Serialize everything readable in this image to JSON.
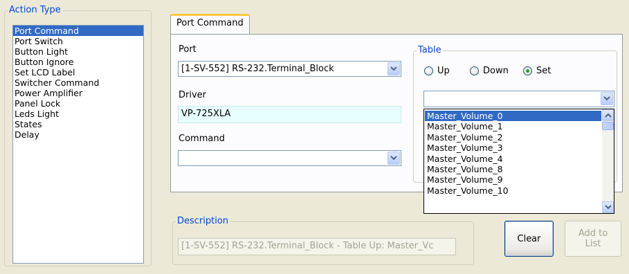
{
  "action_type": {
    "legend": "Action Type",
    "items": [
      "Port Command",
      "Port Switch",
      "Button Light",
      "Button Ignore",
      "Set LCD Label",
      "Switcher Command",
      "Power Amplifier",
      "Panel Lock",
      "Leds Light",
      "States",
      "Delay"
    ],
    "selected": "Port Command"
  },
  "tab": {
    "label": "Port Command"
  },
  "port": {
    "label": "Port",
    "value": "[1-SV-552] RS-232.Terminal_Block"
  },
  "driver": {
    "label": "Driver",
    "value": "VP-725XLA"
  },
  "command": {
    "label": "Command",
    "value": ""
  },
  "table": {
    "legend": "Table",
    "radios": [
      {
        "label": "Up",
        "checked": false
      },
      {
        "label": "Down",
        "checked": false
      },
      {
        "label": "Set",
        "checked": true
      }
    ],
    "combo_value": "",
    "options": [
      "Master_Volume_0",
      "Master_Volume_1",
      "Master_Volume_2",
      "Master_Volume_3",
      "Master_Volume_4",
      "Master_Volume_8",
      "Master_Volume_9",
      "Master_Volume_10"
    ],
    "highlighted": "Master_Volume_0"
  },
  "description": {
    "legend": "Description",
    "value": "[1-SV-552] RS-232.Terminal_Block - Table Up: Master_Vc"
  },
  "buttons": {
    "clear": "Clear",
    "add_line1": "Add to",
    "add_line2": "List"
  },
  "icons": {
    "combo_arrow": "chevron-down-icon",
    "scroll_up": "chevron-up-icon",
    "scroll_down": "chevron-down-icon"
  },
  "colors": {
    "window_bg": "#ece9d8",
    "group_legend": "#0046d5",
    "selection": "#316ac5",
    "driver_bg": "#e8ffff",
    "tab_accent": "#ffc83c"
  }
}
